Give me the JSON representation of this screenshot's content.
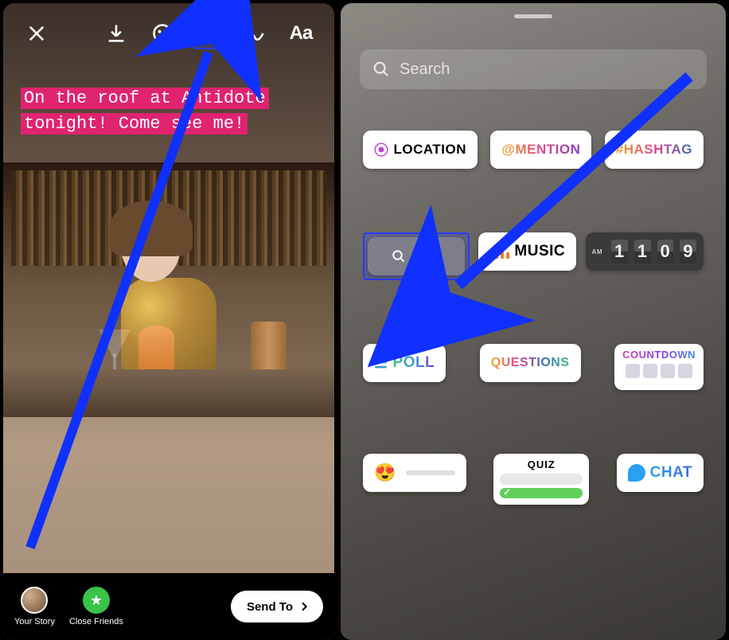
{
  "left": {
    "toolbar": {
      "text_tool": "Aa"
    },
    "caption": "On the roof at Antidote tonight! Come see me!",
    "bottom": {
      "your_story": "Your Story",
      "close_friends": "Close Friends",
      "send_to": "Send To"
    }
  },
  "right": {
    "search_placeholder": "Search",
    "stickers": {
      "location": "LOCATION",
      "mention": "@MENTION",
      "hashtag": "#HASHTAG",
      "gif": "GIF",
      "music": "MUSIC",
      "time": {
        "am": "AM",
        "digits": "1109"
      },
      "poll": "POLL",
      "questions": "QUESTIONS",
      "countdown": "COUNTDOWN",
      "quiz": "QUIZ",
      "chat": "CHAT"
    }
  }
}
